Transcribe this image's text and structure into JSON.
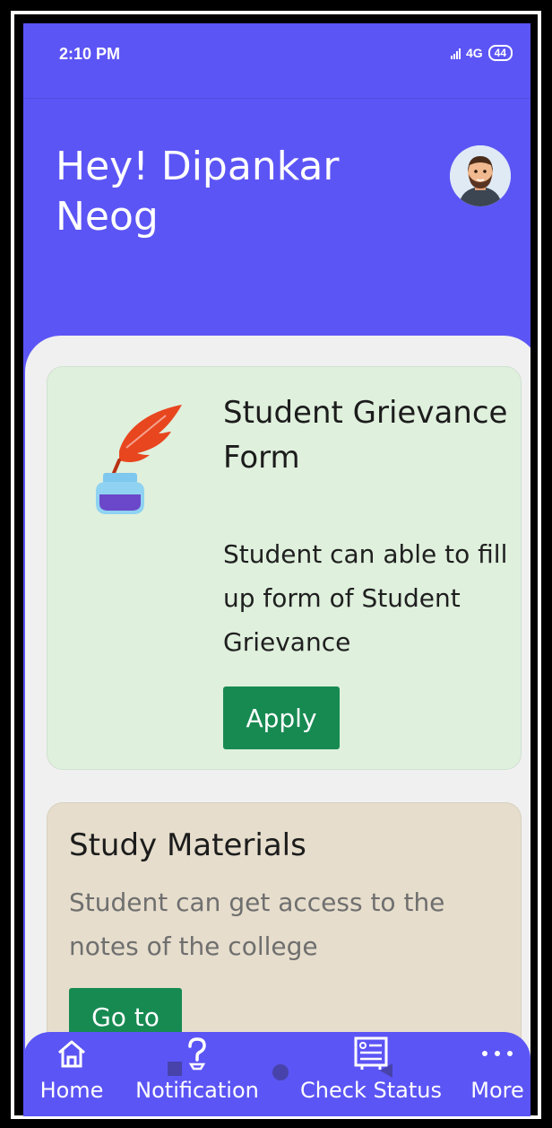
{
  "status_bar": {
    "time": "2:10 PM",
    "network": "4G",
    "battery": "44"
  },
  "header": {
    "greeting": "Hey! Dipankar Neog",
    "avatar_icon": "user-avatar-icon"
  },
  "cards": {
    "grievance": {
      "title": "Student Grievance Form",
      "description": "Student can able to fill up form of Student Grievance",
      "button_label": "Apply",
      "icon": "quill-ink-icon"
    },
    "study": {
      "title": "Study Materials",
      "description": "Student can get access to the notes of the college",
      "button_label": "Go to"
    }
  },
  "bottom_nav": {
    "items": [
      {
        "label": "Home",
        "icon": "home-icon"
      },
      {
        "label": "Notification",
        "icon": "question-icon"
      },
      {
        "label": "Check Status",
        "icon": "status-list-icon"
      },
      {
        "label": "More",
        "icon": "more-dots-icon"
      }
    ]
  },
  "colors": {
    "primary": "#5c55f5",
    "card_green": "#dff0dd",
    "card_beige": "#e6ddcc",
    "button": "#178a52"
  }
}
